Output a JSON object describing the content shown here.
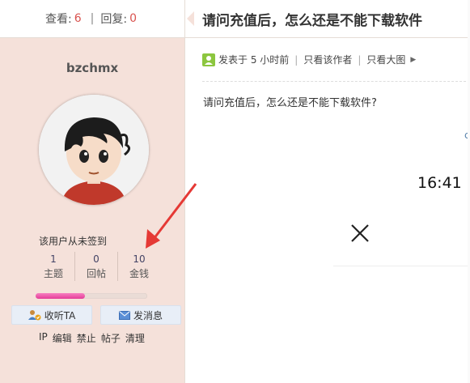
{
  "stats": {
    "views_label": "查看:",
    "views": "6",
    "sep": "|",
    "replies_label": "回复:",
    "replies": "0"
  },
  "thread": {
    "title": "请问充值后，怎么还是不能下载软件"
  },
  "author": {
    "username": "bzchmx",
    "checkin": "该用户从未签到",
    "counts": [
      {
        "value": "1",
        "label": "主题"
      },
      {
        "value": "0",
        "label": "回帖"
      },
      {
        "value": "10",
        "label": "金钱"
      }
    ],
    "progress": 0.44,
    "follow_label": "收听TA",
    "message_label": "发消息",
    "admin_links": [
      "IP",
      "编辑",
      "禁止",
      "帖子",
      "清理"
    ]
  },
  "post": {
    "posted": "发表于 5 小时前",
    "author_only": "只看该作者",
    "large_images": "只看大图",
    "content": "请问充值后，怎么还是不能下载软件?"
  },
  "overlay": {
    "time": "16:41",
    "edge_char": "c"
  },
  "colors": {
    "accent_red": "#d9534f",
    "sidebar_bg": "#f5e1da",
    "progress": "#e43c98"
  }
}
